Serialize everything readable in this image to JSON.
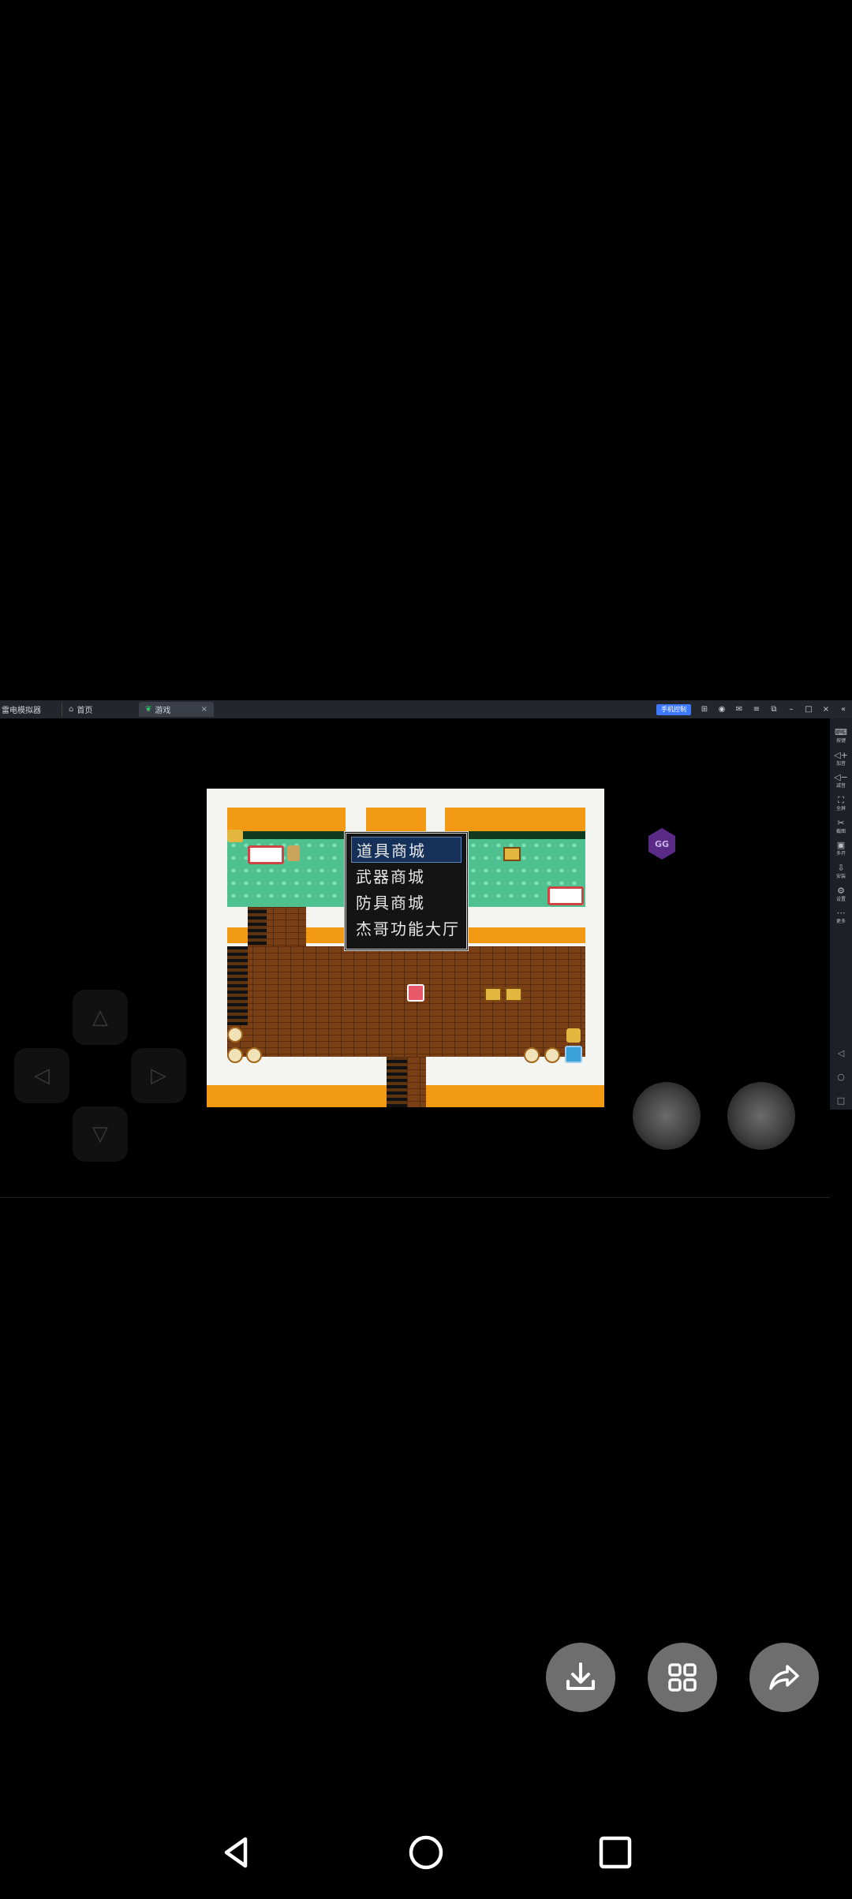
{
  "emulator": {
    "app_name": "雷电模拟器",
    "tabs": [
      {
        "label": "首页",
        "icon": "home-icon"
      },
      {
        "label": "游戏",
        "icon": "leaf-icon"
      }
    ],
    "badge": "手机控制",
    "side_toolbar": [
      {
        "label": "按键",
        "icon": "keyboard-icon"
      },
      {
        "label": "加音",
        "icon": "volume-up-icon"
      },
      {
        "label": "减音",
        "icon": "volume-down-icon"
      },
      {
        "label": "全屏",
        "icon": "fullscreen-icon"
      },
      {
        "label": "截图",
        "icon": "scissors-icon"
      },
      {
        "label": "多开",
        "icon": "multi-window-icon"
      },
      {
        "label": "安装",
        "icon": "install-icon"
      },
      {
        "label": "设置",
        "icon": "settings-icon"
      },
      {
        "label": "更多",
        "icon": "more-icon"
      }
    ]
  },
  "game": {
    "menu": {
      "items": [
        "道具商城",
        "武器商城",
        "防具商城",
        "杰哥功能大厅"
      ],
      "selected_index": 0
    },
    "overlay_label": "GG"
  },
  "colors": {
    "menu_selected": "#15315a",
    "wall": "#f29a13",
    "carpet": "#4fc191",
    "floor": "#7b3f16"
  }
}
